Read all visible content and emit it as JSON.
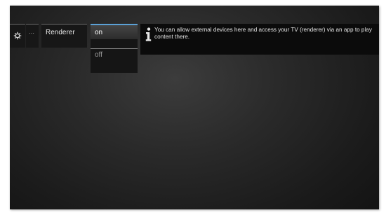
{
  "menu": {
    "gear_icon": "gear-icon",
    "more_label": "···",
    "renderer_label": "Renderer"
  },
  "options": {
    "items": [
      {
        "label": "on",
        "selected": true
      },
      {
        "label": "off",
        "selected": false
      }
    ]
  },
  "info": {
    "icon": "info-icon",
    "text": "You can allow external devices here and access your TV (renderer) via an app to play content there."
  },
  "colors": {
    "highlight": "#5ba1d6",
    "background": "#1b1b1b"
  }
}
